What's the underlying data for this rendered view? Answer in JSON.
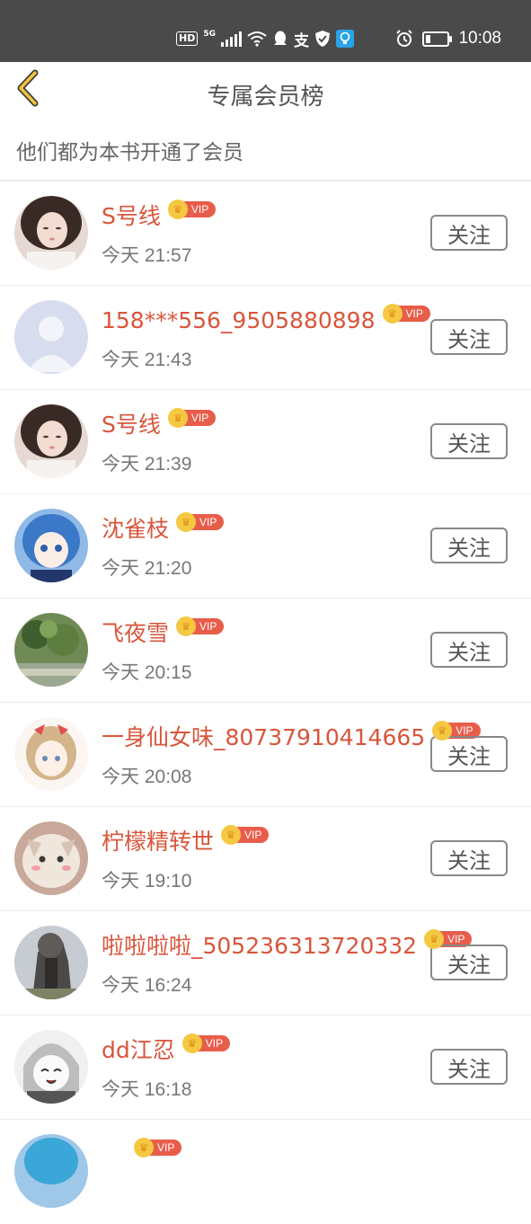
{
  "status_bar": {
    "time": "10:08",
    "hd": "HD",
    "network": "5G",
    "icons": [
      "signal-icon",
      "wifi-icon",
      "qq-icon",
      "alipay-icon",
      "shield-icon",
      "bulb-icon",
      "alarm-icon",
      "battery-icon"
    ]
  },
  "header": {
    "title": "专属会员榜",
    "back_icon": "chevron-left-icon"
  },
  "subtitle": "他们都为本书开通了会员",
  "follow_label": "关注",
  "vip_label": "VIP",
  "colors": {
    "accent_name": "#d9553b",
    "vip_tag": "#e85d4a",
    "crown": "#f5c842",
    "back_arrow": "#e0b430"
  },
  "members": [
    {
      "name": "S号线",
      "time": "今天 21:57",
      "avatar": "girl-photo"
    },
    {
      "name": "158***556_9505880898",
      "time": "今天 21:43",
      "avatar": "default-avatar"
    },
    {
      "name": "S号线",
      "time": "今天 21:39",
      "avatar": "girl-photo"
    },
    {
      "name": "沈雀枝",
      "time": "今天 21:20",
      "avatar": "anime-blue-hair"
    },
    {
      "name": "飞夜雪",
      "time": "今天 20:15",
      "avatar": "plants-photo"
    },
    {
      "name": "一身仙女味_80737910414665",
      "time": "今天 20:08",
      "avatar": "cartoon-girl-bow"
    },
    {
      "name": "柠檬精转世",
      "time": "今天 19:10",
      "avatar": "cat-photo"
    },
    {
      "name": "啦啦啦啦_505236313720332",
      "time": "今天 16:24",
      "avatar": "tree-photo"
    },
    {
      "name": "dd江忍",
      "time": "今天 16:18",
      "avatar": "manga-girl"
    },
    {
      "name": "",
      "time": "",
      "avatar": "partial"
    }
  ]
}
